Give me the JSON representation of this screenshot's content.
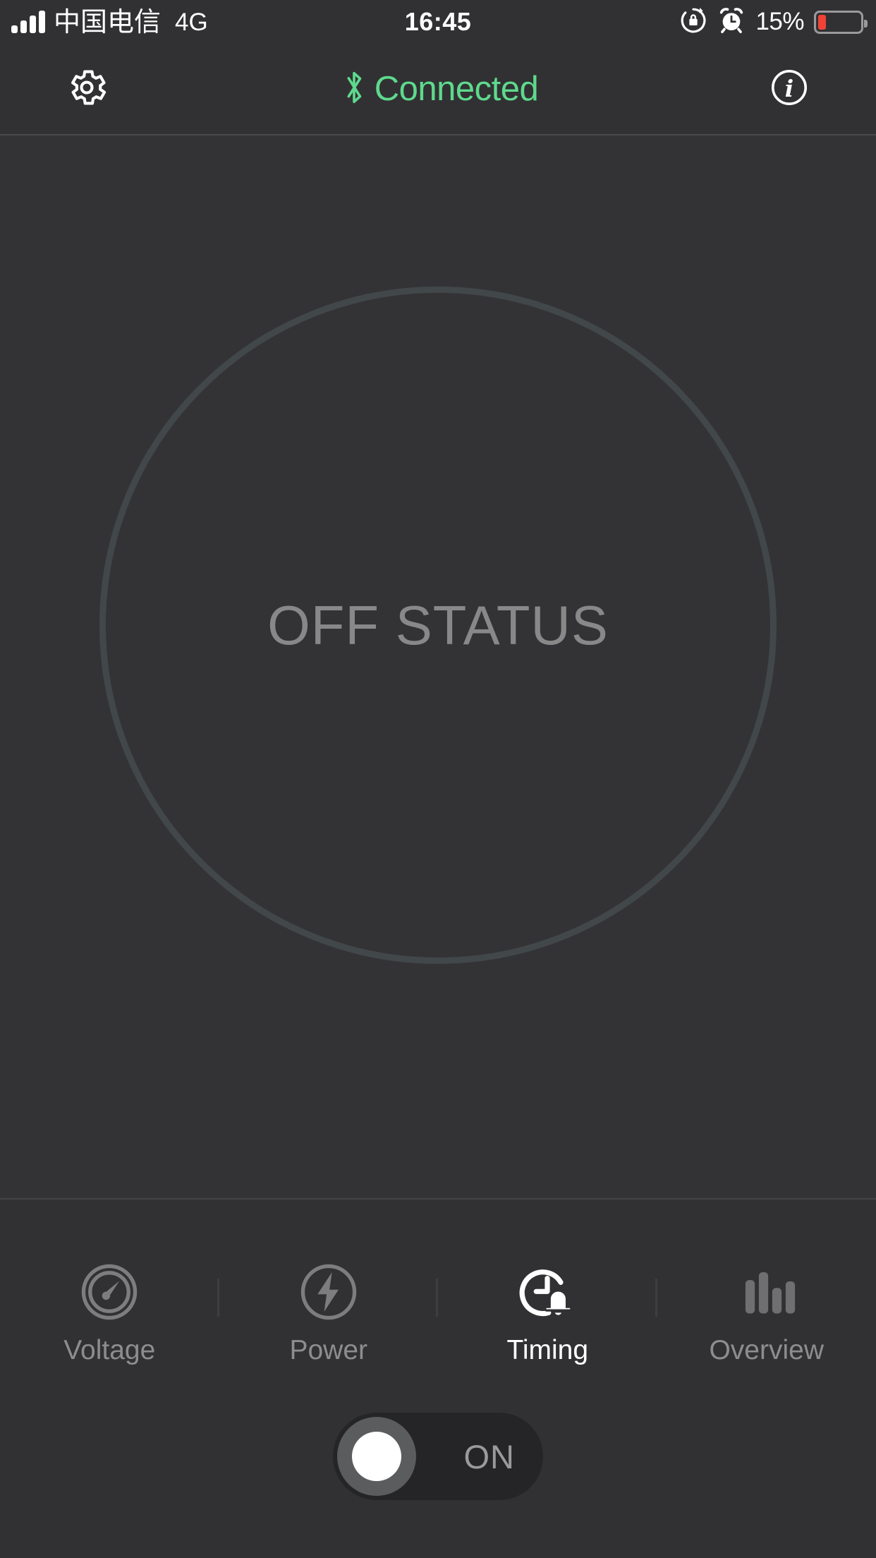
{
  "status_bar": {
    "carrier": "中国电信",
    "network": "4G",
    "time": "16:45",
    "battery_percent": "15%",
    "battery_level": 15,
    "signal_bars": 4,
    "icons": [
      "signal-bars-icon",
      "rotation-lock-icon",
      "alarm-clock-icon",
      "battery-icon"
    ],
    "battery_color": "#f04237"
  },
  "header": {
    "settings_icon": "gear-icon",
    "connection_status": "Connected",
    "bluetooth_icon": "bluetooth-icon",
    "info_icon": "info-icon",
    "accent_color": "#5ed98d"
  },
  "main": {
    "device_status": "OFF STATUS",
    "circle_border_color": "#42474a",
    "status_text_color": "#888889"
  },
  "tabs": [
    {
      "label": "Voltage",
      "icon": "gauge-icon",
      "active": false
    },
    {
      "label": "Power",
      "icon": "lightning-icon",
      "active": false
    },
    {
      "label": "Timing",
      "icon": "clock-bell-icon",
      "active": true
    },
    {
      "label": "Overview",
      "icon": "bar-chart-icon",
      "active": false
    }
  ],
  "power_toggle": {
    "label": "ON",
    "state": "off",
    "knob_position": "left"
  }
}
